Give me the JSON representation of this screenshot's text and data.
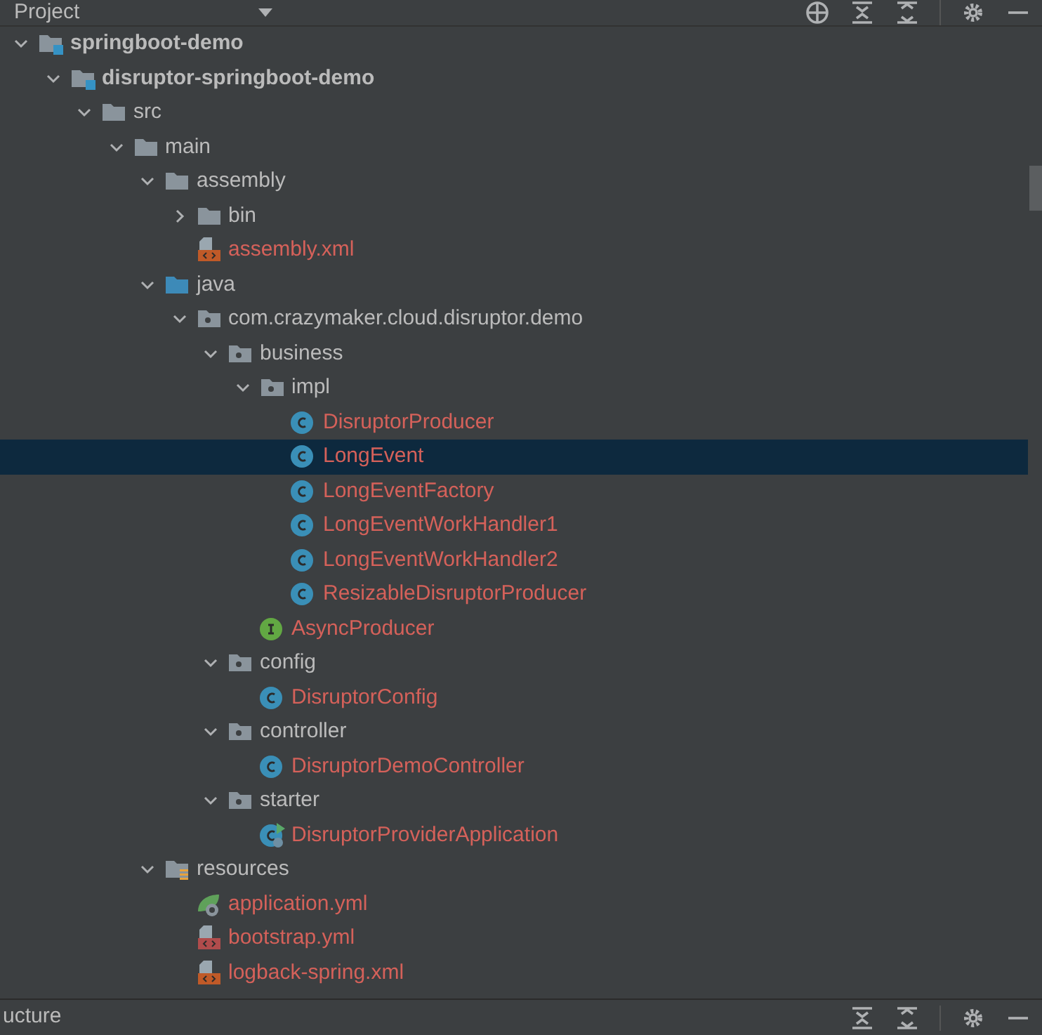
{
  "header": {
    "title": "Project"
  },
  "tree": [
    {
      "label": "springboot-demo",
      "kind": "module",
      "expanded": true,
      "selected": false,
      "unversioned": false,
      "children": [
        {
          "label": "disruptor-springboot-demo",
          "kind": "module",
          "expanded": true,
          "selected": false,
          "unversioned": false,
          "children": [
            {
              "label": "src",
              "kind": "folder",
              "expanded": true,
              "selected": false,
              "unversioned": false,
              "children": [
                {
                  "label": "main",
                  "kind": "folder",
                  "expanded": true,
                  "selected": false,
                  "unversioned": false,
                  "children": [
                    {
                      "label": "assembly",
                      "kind": "folder",
                      "expanded": true,
                      "selected": false,
                      "unversioned": false,
                      "children": [
                        {
                          "label": "bin",
                          "kind": "folder",
                          "expanded": false,
                          "selected": false,
                          "unversioned": false
                        },
                        {
                          "label": "assembly.xml",
                          "kind": "xml",
                          "selected": false,
                          "unversioned": true
                        }
                      ]
                    },
                    {
                      "label": "java",
                      "kind": "source",
                      "expanded": true,
                      "selected": false,
                      "unversioned": false,
                      "children": [
                        {
                          "label": "com.crazymaker.cloud.disruptor.demo",
                          "kind": "package",
                          "expanded": true,
                          "selected": false,
                          "unversioned": false,
                          "children": [
                            {
                              "label": "business",
                              "kind": "package",
                              "expanded": true,
                              "selected": false,
                              "unversioned": false,
                              "children": [
                                {
                                  "label": "impl",
                                  "kind": "package",
                                  "expanded": true,
                                  "selected": false,
                                  "unversioned": false,
                                  "children": [
                                    {
                                      "label": "DisruptorProducer",
                                      "kind": "class",
                                      "selected": false,
                                      "unversioned": true
                                    },
                                    {
                                      "label": "LongEvent",
                                      "kind": "class",
                                      "selected": true,
                                      "unversioned": true
                                    },
                                    {
                                      "label": "LongEventFactory",
                                      "kind": "class",
                                      "selected": false,
                                      "unversioned": true
                                    },
                                    {
                                      "label": "LongEventWorkHandler1",
                                      "kind": "class",
                                      "selected": false,
                                      "unversioned": true
                                    },
                                    {
                                      "label": "LongEventWorkHandler2",
                                      "kind": "class",
                                      "selected": false,
                                      "unversioned": true
                                    },
                                    {
                                      "label": "ResizableDisruptorProducer",
                                      "kind": "class",
                                      "selected": false,
                                      "unversioned": true
                                    }
                                  ]
                                },
                                {
                                  "label": "AsyncProducer",
                                  "kind": "interface",
                                  "selected": false,
                                  "unversioned": true
                                }
                              ]
                            },
                            {
                              "label": "config",
                              "kind": "package",
                              "expanded": true,
                              "selected": false,
                              "unversioned": false,
                              "children": [
                                {
                                  "label": "DisruptorConfig",
                                  "kind": "class",
                                  "selected": false,
                                  "unversioned": true
                                }
                              ]
                            },
                            {
                              "label": "controller",
                              "kind": "package",
                              "expanded": true,
                              "selected": false,
                              "unversioned": false,
                              "children": [
                                {
                                  "label": "DisruptorDemoController",
                                  "kind": "class",
                                  "selected": false,
                                  "unversioned": true
                                }
                              ]
                            },
                            {
                              "label": "starter",
                              "kind": "package",
                              "expanded": true,
                              "selected": false,
                              "unversioned": false,
                              "children": [
                                {
                                  "label": "DisruptorProviderApplication",
                                  "kind": "app",
                                  "selected": false,
                                  "unversioned": true
                                }
                              ]
                            }
                          ]
                        }
                      ]
                    },
                    {
                      "label": "resources",
                      "kind": "resources",
                      "expanded": true,
                      "selected": false,
                      "unversioned": false,
                      "children": [
                        {
                          "label": "application.yml",
                          "kind": "springyml",
                          "selected": false,
                          "unversioned": true
                        },
                        {
                          "label": "bootstrap.yml",
                          "kind": "yml",
                          "selected": false,
                          "unversioned": true
                        },
                        {
                          "label": "logback-spring.xml",
                          "kind": "xml",
                          "selected": false,
                          "unversioned": true
                        }
                      ]
                    }
                  ]
                }
              ]
            }
          ]
        }
      ]
    }
  ],
  "bottom_panel": {
    "title": "ucture"
  }
}
